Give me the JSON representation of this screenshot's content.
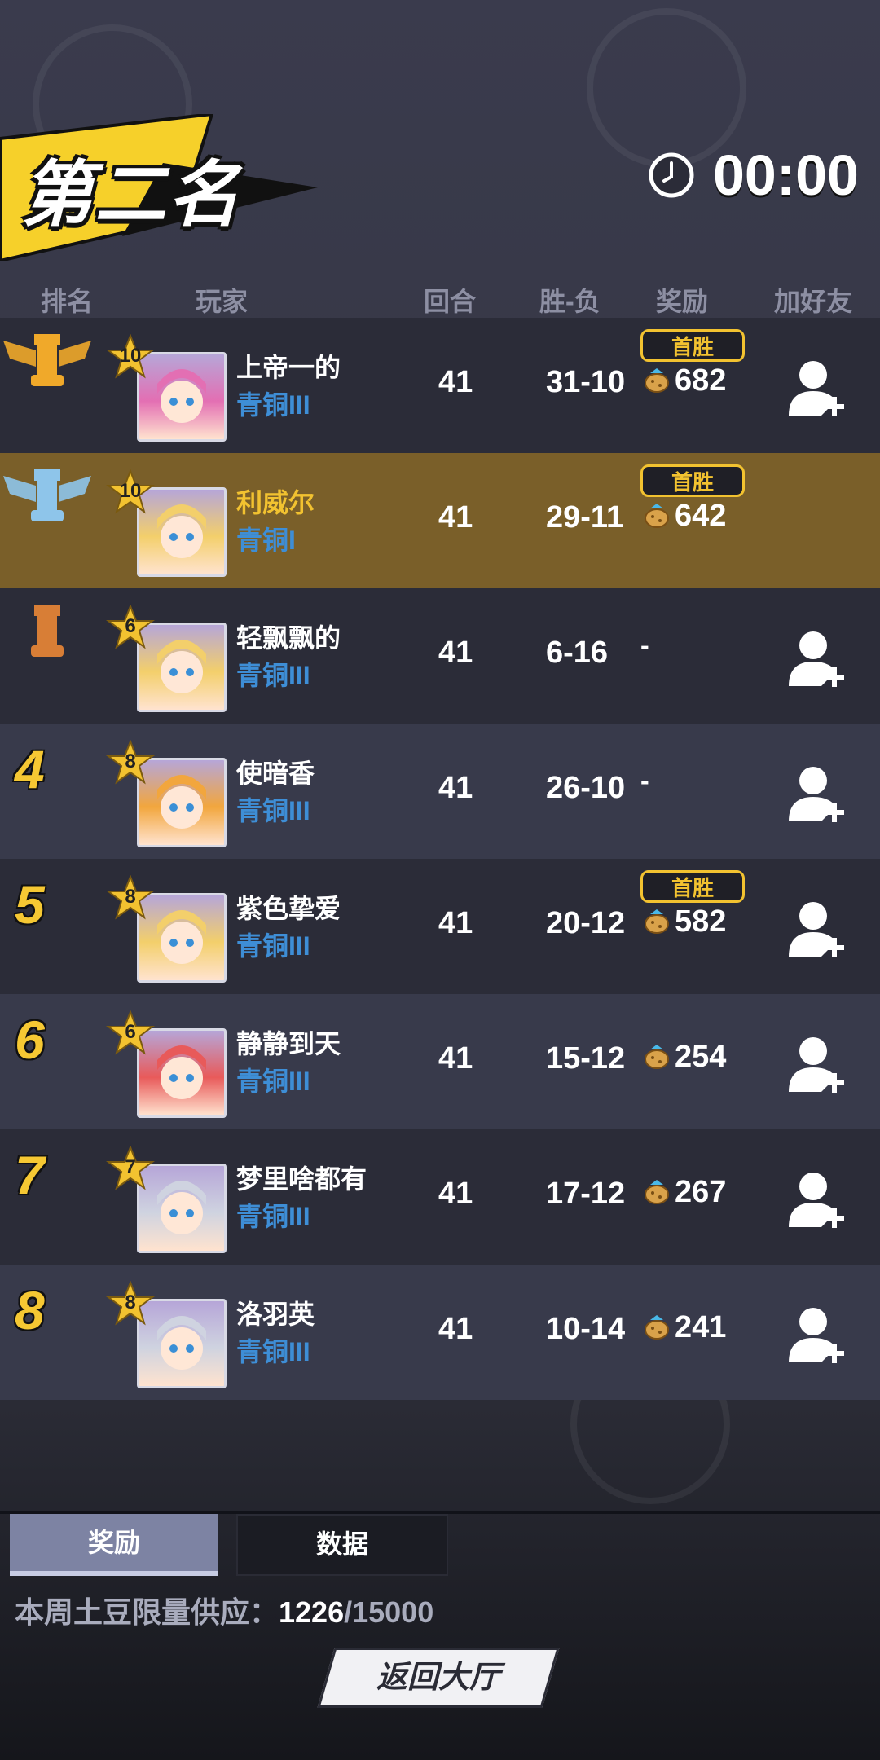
{
  "header": {
    "placement_title": "第二名",
    "timer": "00:00"
  },
  "columns": {
    "rank": "排名",
    "player": "玩家",
    "rounds": "回合",
    "win_loss": "胜-负",
    "reward": "奖励",
    "add_friend": "加好友"
  },
  "first_win_label": "首胜",
  "players": [
    {
      "rank": "1",
      "rank_icon": "gold-rook-trophy-icon",
      "level": "10",
      "name": "上帝一的",
      "tier": "青铜III",
      "rounds": "41",
      "win_loss": "31-10",
      "first_win": true,
      "reward": "682",
      "can_add": true
    },
    {
      "rank": "2",
      "rank_icon": "silver-rook-trophy-icon",
      "level": "10",
      "name": "利威尔",
      "tier": "青铜I",
      "rounds": "41",
      "win_loss": "29-11",
      "first_win": true,
      "reward": "642",
      "can_add": false,
      "self": true
    },
    {
      "rank": "3",
      "rank_icon": "bronze-rook-trophy-icon",
      "level": "6",
      "name": "轻飘飘的",
      "tier": "青铜III",
      "rounds": "41",
      "win_loss": "6-16",
      "first_win": false,
      "reward": "-",
      "can_add": true
    },
    {
      "rank": "4",
      "level": "8",
      "name": "使暗香",
      "tier": "青铜III",
      "rounds": "41",
      "win_loss": "26-10",
      "first_win": false,
      "reward": "-",
      "can_add": true
    },
    {
      "rank": "5",
      "level": "8",
      "name": "紫色挚爱",
      "tier": "青铜III",
      "rounds": "41",
      "win_loss": "20-12",
      "first_win": true,
      "reward": "582",
      "can_add": true
    },
    {
      "rank": "6",
      "level": "6",
      "name": "静静到天",
      "tier": "青铜III",
      "rounds": "41",
      "win_loss": "15-12",
      "first_win": false,
      "reward": "254",
      "can_add": true
    },
    {
      "rank": "7",
      "level": "7",
      "name": "梦里啥都有",
      "tier": "青铜III",
      "rounds": "41",
      "win_loss": "17-12",
      "first_win": false,
      "reward": "267",
      "can_add": true
    },
    {
      "rank": "8",
      "level": "8",
      "name": "洛羽英",
      "tier": "青铜III",
      "rounds": "41",
      "win_loss": "10-14",
      "first_win": false,
      "reward": "241",
      "can_add": true
    }
  ],
  "tabs": {
    "reward": "奖励",
    "data": "数据"
  },
  "supply": {
    "label": "本周土豆限量供应：",
    "current": "1226",
    "max": "/15000"
  },
  "back_button": "返回大厅",
  "colors": {
    "accent_gold": "#f2c230",
    "tier_blue": "#3e8ed6",
    "highlight_row": "#7a5f29"
  }
}
